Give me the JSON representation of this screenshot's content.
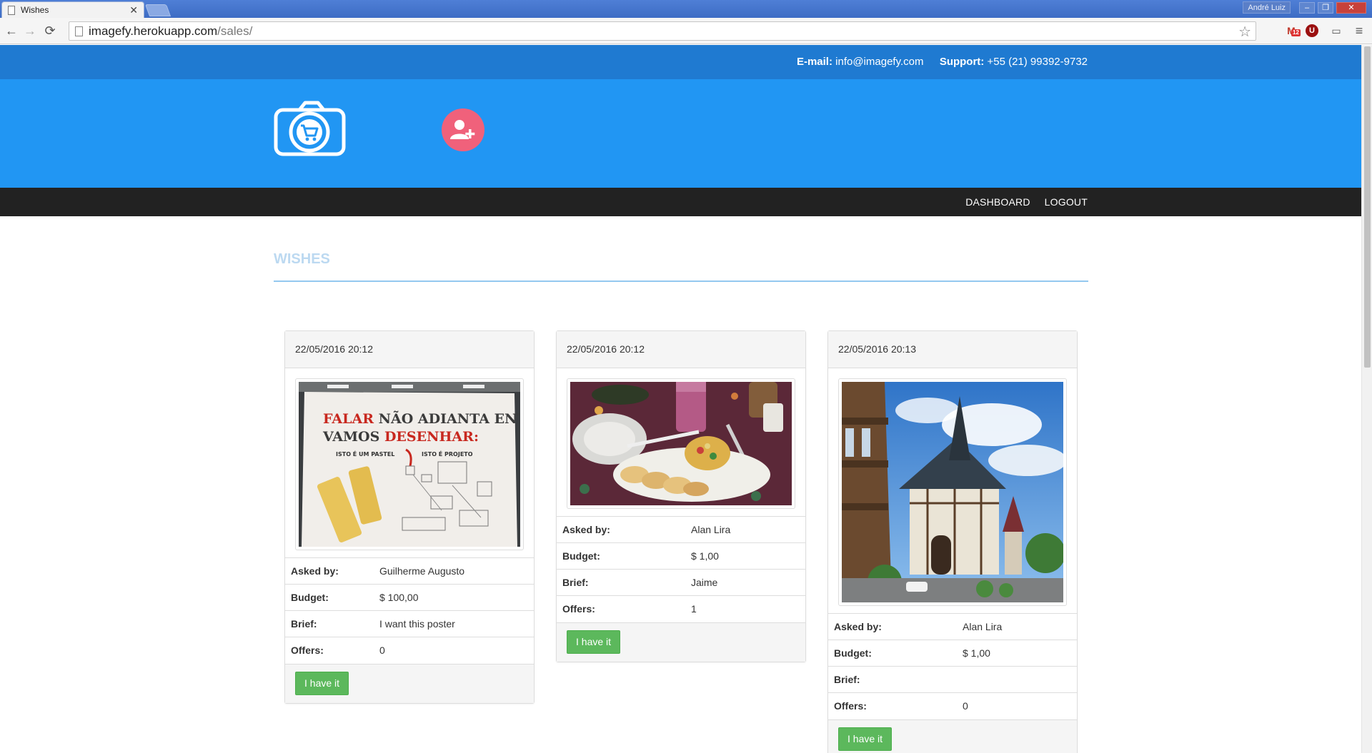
{
  "browser": {
    "tab_title": "Wishes",
    "tab_close": "✕",
    "user_label": "André Luiz",
    "url_host": "imagefy.herokuapp.com",
    "url_path": "/sales/",
    "gmail_badge": "12",
    "ext_u": "U"
  },
  "contact": {
    "email_label": "E-mail:",
    "email": "info@imagefy.com",
    "support_label": "Support:",
    "phone": "+55 (21) 99392-9732"
  },
  "nav": {
    "dashboard": "DASHBOARD",
    "logout": "LOGOUT"
  },
  "page": {
    "title": "WISHES"
  },
  "labels": {
    "asked_by": "Asked by:",
    "budget": "Budget:",
    "brief": "Brief:",
    "offers": "Offers:",
    "action": "I have it"
  },
  "wishes": [
    {
      "date": "22/05/2016 20:12",
      "asked_by": "Guilherme Augusto",
      "budget": "$ 100,00",
      "brief": "I want this poster",
      "offers": "0",
      "poster": {
        "line1a": "FALAR",
        "line1b": " NÃO ADIANTA ENTÃO",
        "line2a": "VAMOS ",
        "line2b": "DESENHAR:",
        "left_caption": "ISTO É UM PASTEL",
        "right_caption": "ISTO É PROJETO"
      }
    },
    {
      "date": "22/05/2016 20:12",
      "asked_by": "Alan Lira",
      "budget": "$ 1,00",
      "brief": "Jaime",
      "offers": "1"
    },
    {
      "date": "22/05/2016 20:13",
      "asked_by": "Alan Lira",
      "budget": "$ 1,00",
      "brief": "",
      "offers": "0"
    }
  ],
  "colors": {
    "topbar": "#1f7ad1",
    "banner": "#2196f3",
    "navbar": "#222222",
    "accent_pink": "#f0617b",
    "button_green": "#5cb85c",
    "title_light_blue": "#bcd9f1"
  }
}
